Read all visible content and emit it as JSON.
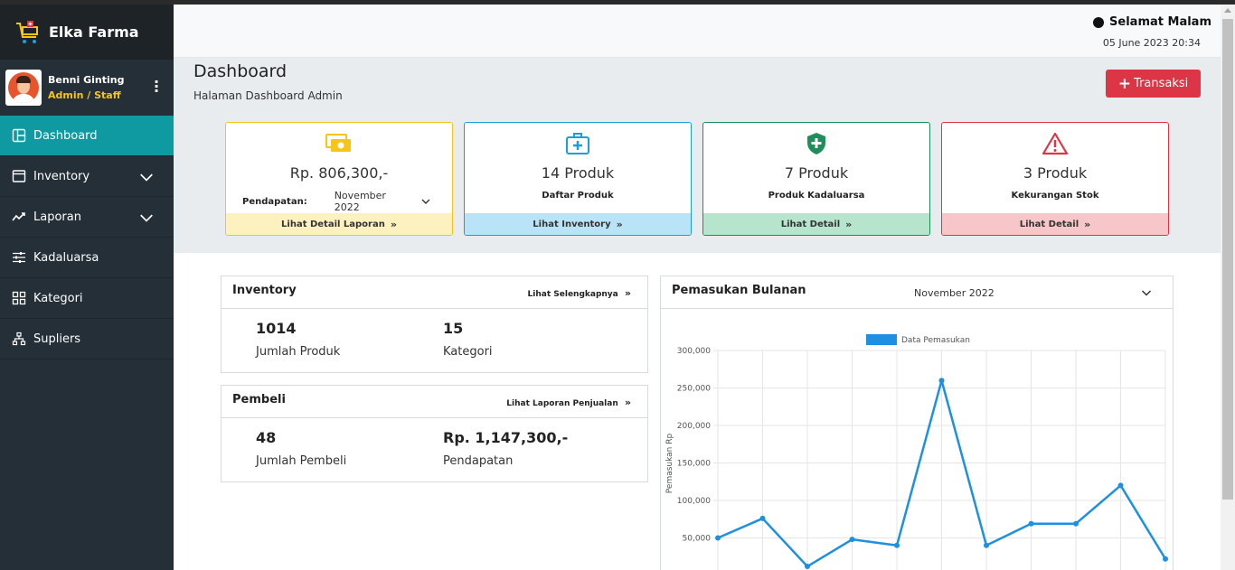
{
  "brand": {
    "name": "Elka Farma"
  },
  "user": {
    "name": "Benni Ginting",
    "role": "Admin / Staff"
  },
  "sidebar": {
    "items": [
      {
        "label": "Dashboard",
        "icon": "dashboard-icon",
        "active": true
      },
      {
        "label": "Inventory",
        "icon": "archive-icon",
        "expandable": true
      },
      {
        "label": "Laporan",
        "icon": "line-chart-icon",
        "expandable": true
      },
      {
        "label": "Kadaluarsa",
        "icon": "sliders-icon"
      },
      {
        "label": "Kategori",
        "icon": "grid-icon"
      },
      {
        "label": "Supliers",
        "icon": "sitemap-icon"
      }
    ]
  },
  "header": {
    "greeting": "Selamat Malam",
    "datetime": "05 June 2023 20:34"
  },
  "page": {
    "title": "Dashboard",
    "subtitle": "Halaman Dashboard Admin",
    "transaksi_button": "Transaksi"
  },
  "cards": [
    {
      "value": "Rp. 806,300,-",
      "label": "Pendapatan:",
      "select": "November 2022",
      "footer": "Lihat Detail Laporan",
      "color": "#f5c518",
      "bg": "#fdf1bf",
      "icon": "money-icon"
    },
    {
      "value": "14 Produk",
      "label": "Daftar Produk",
      "footer": "Lihat Inventory",
      "color": "#1c9fd8",
      "bg": "#b9e3f6",
      "icon": "medkit-icon"
    },
    {
      "value": "7 Produk",
      "label": "Produk Kadaluarsa",
      "footer": "Lihat Detail",
      "color": "#1e8e5a",
      "bg": "#b7e4cc",
      "icon": "shield-plus-icon"
    },
    {
      "value": "3 Produk",
      "label": "Kekurangan Stok",
      "footer": "Lihat Detail",
      "color": "#dc3545",
      "bg": "#f6c6c9",
      "icon": "warning-icon"
    }
  ],
  "inventory_panel": {
    "title": "Inventory",
    "link": "Lihat Selengkapnya",
    "stats": [
      {
        "value": "1014",
        "label": "Jumlah Produk"
      },
      {
        "value": "15",
        "label": "Kategori"
      }
    ]
  },
  "pembeli_panel": {
    "title": "Pembeli",
    "link": "Lihat Laporan Penjualan",
    "stats": [
      {
        "value": "48",
        "label": "Jumlah Pembeli"
      },
      {
        "value": "Rp. 1,147,300,-",
        "label": "Pendapatan"
      }
    ]
  },
  "chart_panel": {
    "title": "Pemasukan Bulanan",
    "month": "November 2022"
  },
  "chart_data": {
    "type": "line",
    "series": [
      {
        "name": "Data Pemasukan",
        "color": "#1e90e0",
        "values": [
          50000,
          76000,
          12000,
          48000,
          40000,
          260000,
          40000,
          69000,
          69000,
          120000,
          22000
        ]
      }
    ],
    "ylabel": "Pemasukan Rp",
    "yticks": [
      "300,000",
      "250,000",
      "200,000",
      "150,000",
      "100,000",
      "50,000"
    ],
    "ytick_values": [
      300000,
      250000,
      200000,
      150000,
      100000,
      50000
    ],
    "ylim": [
      0,
      300000
    ],
    "grid": true,
    "legend": "top-center"
  }
}
